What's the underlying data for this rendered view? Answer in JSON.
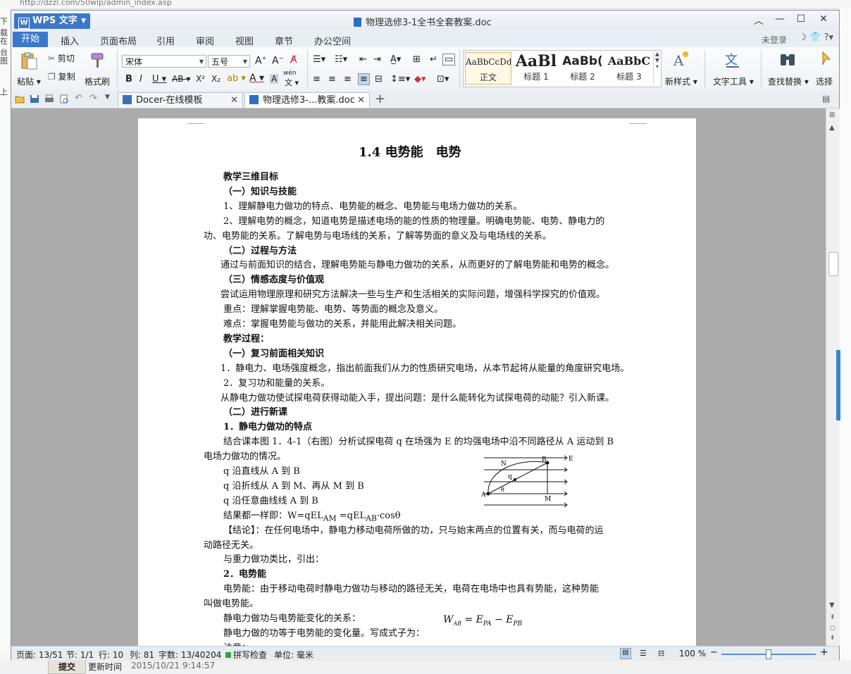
{
  "background": {
    "url": "http://dzzl.com/50wlp/admin_index.asp",
    "left_texts": [
      "下载",
      "在台",
      "图",
      "上"
    ],
    "submit_label": "提交",
    "update_time_label": "更新时间",
    "update_time": "2015/10/21 9:14:57"
  },
  "window": {
    "app_button": "WPS 文字",
    "title": "物理选修3-1全书全套教案.doc",
    "controls": {
      "collapse": "︿",
      "minimize": "—",
      "maximize": "☐",
      "close": "✕"
    }
  },
  "ribbon_tabs": [
    "开始",
    "插入",
    "页面布局",
    "引用",
    "审阅",
    "视图",
    "章节",
    "办公空间"
  ],
  "account": {
    "login": "未登录",
    "help": "?"
  },
  "ribbon": {
    "paste": "粘贴",
    "cut": "剪切",
    "copy": "复制",
    "format_painter": "格式刷",
    "font_name": "宋体",
    "font_size": "五号",
    "pinyin": "wén",
    "styles": [
      {
        "sample": "AaBbCcDd",
        "name": "正文"
      },
      {
        "sample": "AaBl",
        "name": "标题 1"
      },
      {
        "sample": "AaBb(",
        "name": "标题 2"
      },
      {
        "sample": "AaBbC",
        "name": "标题 3"
      }
    ],
    "new_style": "新样式",
    "text_tools": "文字工具",
    "find_replace": "查找替换",
    "select": "选择"
  },
  "doc_tabs": [
    {
      "label": "Docer-在线模板",
      "active": false
    },
    {
      "label": "物理选修3-...教案.doc",
      "active": true
    }
  ],
  "document": {
    "title": "1.4 电势能　电势",
    "lines": [
      {
        "text": "教学三维目标",
        "bold": true
      },
      {
        "text": "（一）知识与技能",
        "bold": true
      },
      {
        "text": "1、理解静电力做功的特点、电势能的概念、电势能与电场力做功的关系。"
      },
      {
        "text": "2、理解电势的概念，知道电势是描述电场的能的性质的物理量。明确电势能、电势、静电力的"
      },
      {
        "text": "功、电势能的关系。了解电势与电场线的关系，了解等势面的意义及与电场线的关系。"
      },
      {
        "text": "（二）过程与方法",
        "bold": true
      },
      {
        "text": "通过与前面知识的结合，理解电势能与静电力做功的关系，从而更好的了解电势能和电势的概念。"
      },
      {
        "text": "（三）情感态度与价值观",
        "bold": true
      },
      {
        "text": "尝试运用物理原理和研究方法解决一些与生产和生活相关的实际问题，增强科学探究的价值观。"
      },
      {
        "text": "重点：理解掌握电势能、电势、等势面的概念及意义。"
      },
      {
        "text": "难点：掌握电势能与做功的关系，并能用此解决相关问题。"
      },
      {
        "text": "教学过程：",
        "bold": true
      },
      {
        "text": "（一）复习前面相关知识",
        "bold": true
      },
      {
        "text": "1．静电力、电场强度概念，指出前面我们从力的性质研究电场，从本节起将从能量的角度研究电场。"
      },
      {
        "text": "2．复习功和能量的关系。"
      },
      {
        "text": "从静电力做功使试探电荷获得动能入手，提出问题：是什么能转化为试探电荷的动能？引入新课。"
      },
      {
        "text": "（二）进行新课",
        "bold": true
      },
      {
        "text": "1．静电力做功的特点",
        "bold": true
      },
      {
        "text": "结合课本图 1．4-1（右图）分析试探电荷 q 在场强为 E 的均强电场中沿不同路径从 A 运动到 B"
      },
      {
        "text": "电场力做功的情况。"
      },
      {
        "text": "q 沿直线从 A 到 B"
      },
      {
        "text": "q 沿折线从 A 到 M、再从 M 到 B"
      },
      {
        "text": "q 沿任意曲线线 A 到 B"
      },
      {
        "text": "结果都一样即：W=qEL<sub>AM</sub> =qEL<sub>AB</sub>·cosθ"
      },
      {
        "text": "【结论】：在任何电场中，静电力移动电荷所做的功，只与始末两点的位置有关，而与电荷的运"
      },
      {
        "text": "动路径无关。"
      },
      {
        "text": "与重力做功类比，引出："
      },
      {
        "text": "2．电势能",
        "bold": true
      },
      {
        "text": "电势能：由于移动电荷时静电力做功与移动的路径无关，电荷在电场中也具有势能，这种势能"
      },
      {
        "text": "叫做电势能。"
      },
      {
        "text": "静电力做功与电势能变化的关系："
      },
      {
        "text": "静电力做的功等于电势能的变化量。写成式子为："
      },
      {
        "text": "注意："
      }
    ],
    "formula": "W = E − E",
    "formula_subs": [
      "AB",
      "PA",
      "PB"
    ],
    "diagram_labels": [
      "E",
      "N",
      "B",
      "q",
      "θ",
      "A",
      "M"
    ]
  },
  "status": {
    "page": "页面: 13/51",
    "section": "节: 1/1",
    "row": "行: 10",
    "col": "列: 81",
    "words": "字数: 13/40204",
    "spell": "拼写检查",
    "unit": "单位: 毫米",
    "zoom": "100 %"
  }
}
